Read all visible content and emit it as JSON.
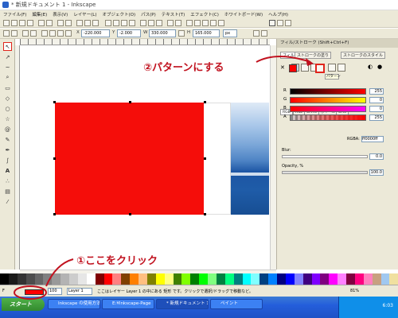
{
  "title_bar": {
    "title": "* 新規ドキュメント 1 - Inkscape"
  },
  "menu": [
    "ファイル(F)",
    "編集(E)",
    "表示(V)",
    "レイヤー(L)",
    "オブジェクト(O)",
    "パス(P)",
    "テキスト(T)",
    "エフェクト(C)",
    "ホワイトボード(W)",
    "ヘルプ(H)"
  ],
  "toolbar2": {
    "x": "-220.000",
    "y": "-2.000",
    "w": "330.000",
    "h": "165.000",
    "unit": "px"
  },
  "fill_panel": {
    "title": "フィル/ストローク (Shift+Ctrl+F)",
    "tabs": [
      "フィル",
      "ストロークの塗り",
      "ストロークのスタイル"
    ],
    "tooltip": "パターン",
    "color_tabs": [
      "RGB",
      "HSL",
      "CMYK",
      "ホイール",
      "CMS"
    ],
    "channels": [
      {
        "label": "R",
        "value": "255"
      },
      {
        "label": "G",
        "value": "0"
      },
      {
        "label": "B",
        "value": "0"
      },
      {
        "label": "A",
        "value": "255"
      }
    ],
    "rgba_label": "RGBA:",
    "rgba_value": "ff0000ff",
    "blur_label": "Blur:",
    "blur_value": "0.0",
    "opacity_label": "Opacity, %",
    "opacity_value": "100.0"
  },
  "statusbar": {
    "layer_value": "Layer 1",
    "message": "ここはレイヤー Layer 1 の中にある 矩形 です。クリックで選択/ドラッグで移動など。",
    "opacity_value": "100",
    "zoom": "81%"
  },
  "taskbar": {
    "start": "スタート",
    "items": [
      "Inkscape の使用方法",
      "E:¥Inkscape-Page",
      "* 新規ドキュメント 1",
      "ペイント"
    ],
    "clock": "6:03"
  },
  "annotations": {
    "step1": "①ここをクリック",
    "step2": "②パターンにする"
  },
  "colors": {
    "accent": "#c1121f",
    "fill": "#ff0000"
  }
}
